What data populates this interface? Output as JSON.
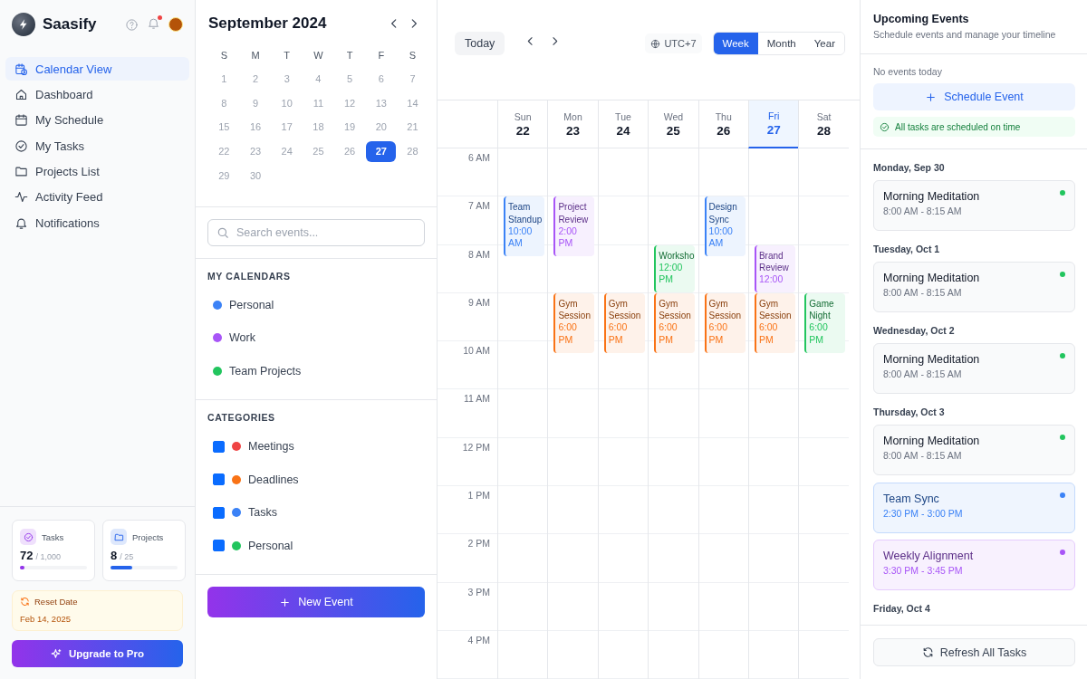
{
  "sidebar": {
    "brand": "Saasify",
    "notifications_unread": true,
    "nav": [
      {
        "label": "Calendar View",
        "selected": true
      },
      {
        "label": "Dashboard",
        "selected": false
      },
      {
        "label": "My Schedule",
        "selected": false
      },
      {
        "label": "My Tasks",
        "selected": false
      },
      {
        "label": "Projects List",
        "selected": false
      },
      {
        "label": "Activity Feed",
        "selected": false
      },
      {
        "label": "Notifications",
        "selected": false
      }
    ],
    "stats": [
      {
        "label": "Tasks",
        "value": "72",
        "limit": "/ 1,000",
        "level": 0.07,
        "color": "#9333ea"
      },
      {
        "label": "Projects",
        "value": "8",
        "limit": "/ 25",
        "level": 0.32,
        "color": "#2563eb"
      }
    ],
    "reset": {
      "label": "Reset Date",
      "date": "Feb 14, 2025"
    },
    "upgrade_button": "Upgrade to Pro"
  },
  "mini_calendar": {
    "title": "September 2024",
    "weekdays": [
      "S",
      "M",
      "T",
      "W",
      "T",
      "F",
      "S"
    ],
    "days": [
      {
        "label": "1",
        "selected": false
      },
      {
        "label": "2",
        "selected": false
      },
      {
        "label": "3",
        "selected": false
      },
      {
        "label": "4",
        "selected": false
      },
      {
        "label": "5",
        "selected": false
      },
      {
        "label": "6",
        "selected": false
      },
      {
        "label": "7",
        "selected": false
      },
      {
        "label": "8",
        "selected": false
      },
      {
        "label": "9",
        "selected": false
      },
      {
        "label": "10",
        "selected": false
      },
      {
        "label": "11",
        "selected": false
      },
      {
        "label": "12",
        "selected": false
      },
      {
        "label": "13",
        "selected": false
      },
      {
        "label": "14",
        "selected": false
      },
      {
        "label": "15",
        "selected": false
      },
      {
        "label": "16",
        "selected": false
      },
      {
        "label": "17",
        "selected": false
      },
      {
        "label": "18",
        "selected": false
      },
      {
        "label": "19",
        "selected": false
      },
      {
        "label": "20",
        "selected": false
      },
      {
        "label": "21",
        "selected": false
      },
      {
        "label": "22",
        "selected": false
      },
      {
        "label": "23",
        "selected": false
      },
      {
        "label": "24",
        "selected": false
      },
      {
        "label": "25",
        "selected": false
      },
      {
        "label": "26",
        "selected": false
      },
      {
        "label": "27",
        "selected": true
      },
      {
        "label": "28",
        "selected": false
      },
      {
        "label": "29",
        "selected": false
      },
      {
        "label": "30",
        "selected": false
      }
    ],
    "search": {
      "placeholder": "Search events..."
    },
    "calendars_heading": "MY CALENDARS",
    "calendars": [
      {
        "label": "Personal",
        "color": "#3b82f6"
      },
      {
        "label": "Work",
        "color": "#a855f7"
      },
      {
        "label": "Team Projects",
        "color": "#22c55e"
      }
    ],
    "categories_heading": "CATEGORIES",
    "categories": [
      {
        "label": "Meetings",
        "color": "#ef4444",
        "checked": true
      },
      {
        "label": "Deadlines",
        "color": "#f97316",
        "checked": true
      },
      {
        "label": "Tasks",
        "color": "#3b82f6",
        "checked": true
      },
      {
        "label": "Personal",
        "color": "#22c55e",
        "checked": true
      }
    ],
    "new_event_button": "New Event"
  },
  "week_view": {
    "today_button": "Today",
    "timezone": "UTC+7",
    "views": [
      {
        "label": "Week",
        "selected": true
      },
      {
        "label": "Month",
        "selected": false
      },
      {
        "label": "Year",
        "selected": false
      }
    ],
    "hours": [
      "6 AM",
      "7 AM",
      "8 AM",
      "9 AM",
      "10 AM",
      "11 AM",
      "12 PM",
      "1 PM",
      "2 PM",
      "3 PM",
      "4 PM"
    ],
    "days": [
      {
        "weekday": "Sun",
        "date": "22",
        "selected": false,
        "events": [
          {
            "kind": "early",
            "title": "Team Standup",
            "time": "10:00 AM",
            "color": "#3b82f6"
          }
        ]
      },
      {
        "weekday": "Mon",
        "date": "23",
        "selected": false,
        "events": [
          {
            "kind": "early",
            "title": "Project Review",
            "time": "2:00 PM",
            "color": "#a855f7"
          },
          {
            "kind": "evening",
            "title": "Gym Session",
            "time": "6:00 PM",
            "color": "#f97316"
          }
        ]
      },
      {
        "weekday": "Tue",
        "date": "24",
        "selected": false,
        "events": [
          {
            "kind": "evening",
            "title": "Gym Session",
            "time": "6:00 PM",
            "color": "#f97316"
          }
        ]
      },
      {
        "weekday": "Wed",
        "date": "25",
        "selected": false,
        "events": [
          {
            "kind": "midday",
            "title": "Worksho",
            "time": "12:00 PM",
            "color": "#22c55e"
          },
          {
            "kind": "evening",
            "title": "Gym Session",
            "time": "6:00 PM",
            "color": "#f97316"
          }
        ]
      },
      {
        "weekday": "Thu",
        "date": "26",
        "selected": false,
        "events": [
          {
            "kind": "early",
            "title": "Design Sync",
            "time": "10:00 AM",
            "color": "#3b82f6"
          },
          {
            "kind": "evening",
            "title": "Gym Session",
            "time": "6:00 PM",
            "color": "#f97316"
          }
        ]
      },
      {
        "weekday": "Fri",
        "date": "27",
        "selected": true,
        "events": [
          {
            "kind": "midday",
            "title": "Brand Review",
            "time": "12:00",
            "color": "#a855f7"
          },
          {
            "kind": "evening",
            "title": "Gym Session",
            "time": "6:00 PM",
            "color": "#f97316"
          }
        ]
      },
      {
        "weekday": "Sat",
        "date": "28",
        "selected": false,
        "events": [
          {
            "kind": "evening",
            "title": "Game Night",
            "time": "6:00 PM",
            "color": "#22c55e"
          }
        ]
      }
    ]
  },
  "upcoming": {
    "title": "Upcoming Events",
    "subtitle": "Schedule events and manage your timeline",
    "empty_text": "No events today",
    "schedule_button": "Schedule Event",
    "status": "All tasks are scheduled on time",
    "groups": [
      {
        "date": "Monday, Sep 30",
        "events": [
          {
            "title": "Morning Meditation",
            "time": "8:00 AM - 8:15 AM",
            "color": "#22c55e",
            "highlighted": false
          }
        ]
      },
      {
        "date": "Tuesday, Oct 1",
        "events": [
          {
            "title": "Morning Meditation",
            "time": "8:00 AM - 8:15 AM",
            "color": "#22c55e",
            "highlighted": false
          }
        ]
      },
      {
        "date": "Wednesday, Oct 2",
        "events": [
          {
            "title": "Morning Meditation",
            "time": "8:00 AM - 8:15 AM",
            "color": "#22c55e",
            "highlighted": false
          }
        ]
      },
      {
        "date": "Thursday, Oct 3",
        "events": [
          {
            "title": "Morning Meditation",
            "time": "8:00 AM - 8:15 AM",
            "color": "#22c55e",
            "highlighted": false
          },
          {
            "title": "Team Sync",
            "time": "2:30 PM - 3:00 PM",
            "color": "#3b82f6",
            "highlighted": true
          },
          {
            "title": "Weekly Alignment",
            "time": "3:30 PM - 3:45 PM",
            "color": "#a855f7",
            "highlighted": true
          }
        ]
      },
      {
        "date": "Friday, Oct 4"
      }
    ],
    "refresh_button": "Refresh All Tasks"
  }
}
